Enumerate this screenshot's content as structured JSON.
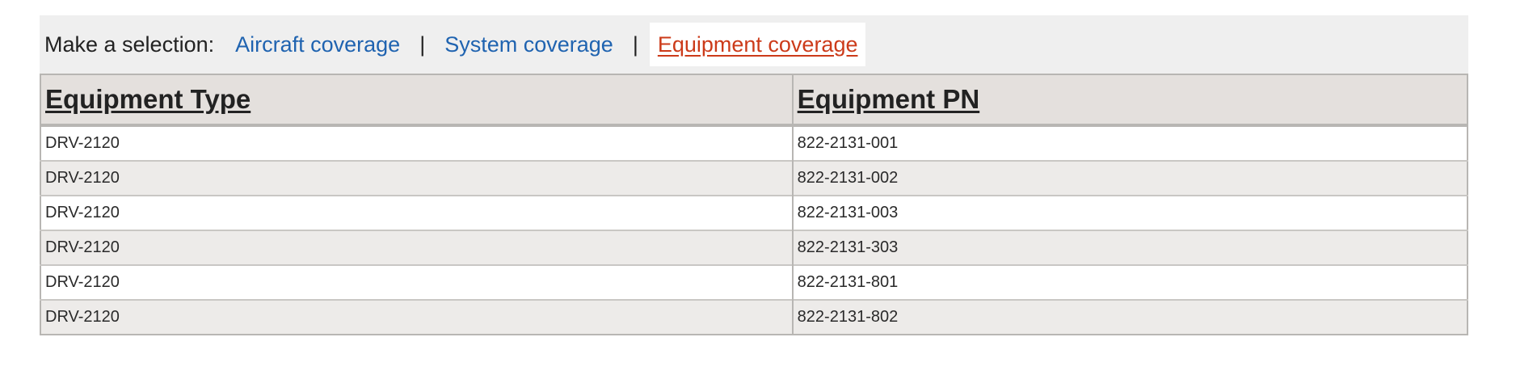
{
  "selector": {
    "label": "Make a selection:",
    "links": [
      {
        "label": "Aircraft coverage",
        "active": false
      },
      {
        "label": "System coverage",
        "active": false
      },
      {
        "label": "Equipment coverage",
        "active": true
      }
    ],
    "separator": "|"
  },
  "table": {
    "headers": [
      "Equipment Type",
      "Equipment PN"
    ],
    "rows": [
      [
        "DRV-2120",
        "822-2131-001"
      ],
      [
        "DRV-2120",
        "822-2131-002"
      ],
      [
        "DRV-2120",
        "822-2131-003"
      ],
      [
        "DRV-2120",
        "822-2131-303"
      ],
      [
        "DRV-2120",
        "822-2131-801"
      ],
      [
        "DRV-2120",
        "822-2131-802"
      ]
    ]
  },
  "colors": {
    "link": "#1f63b0",
    "active_link": "#cc3b1a",
    "header_bg": "#e4e0dd",
    "stripe_bg": "#edebe9"
  }
}
